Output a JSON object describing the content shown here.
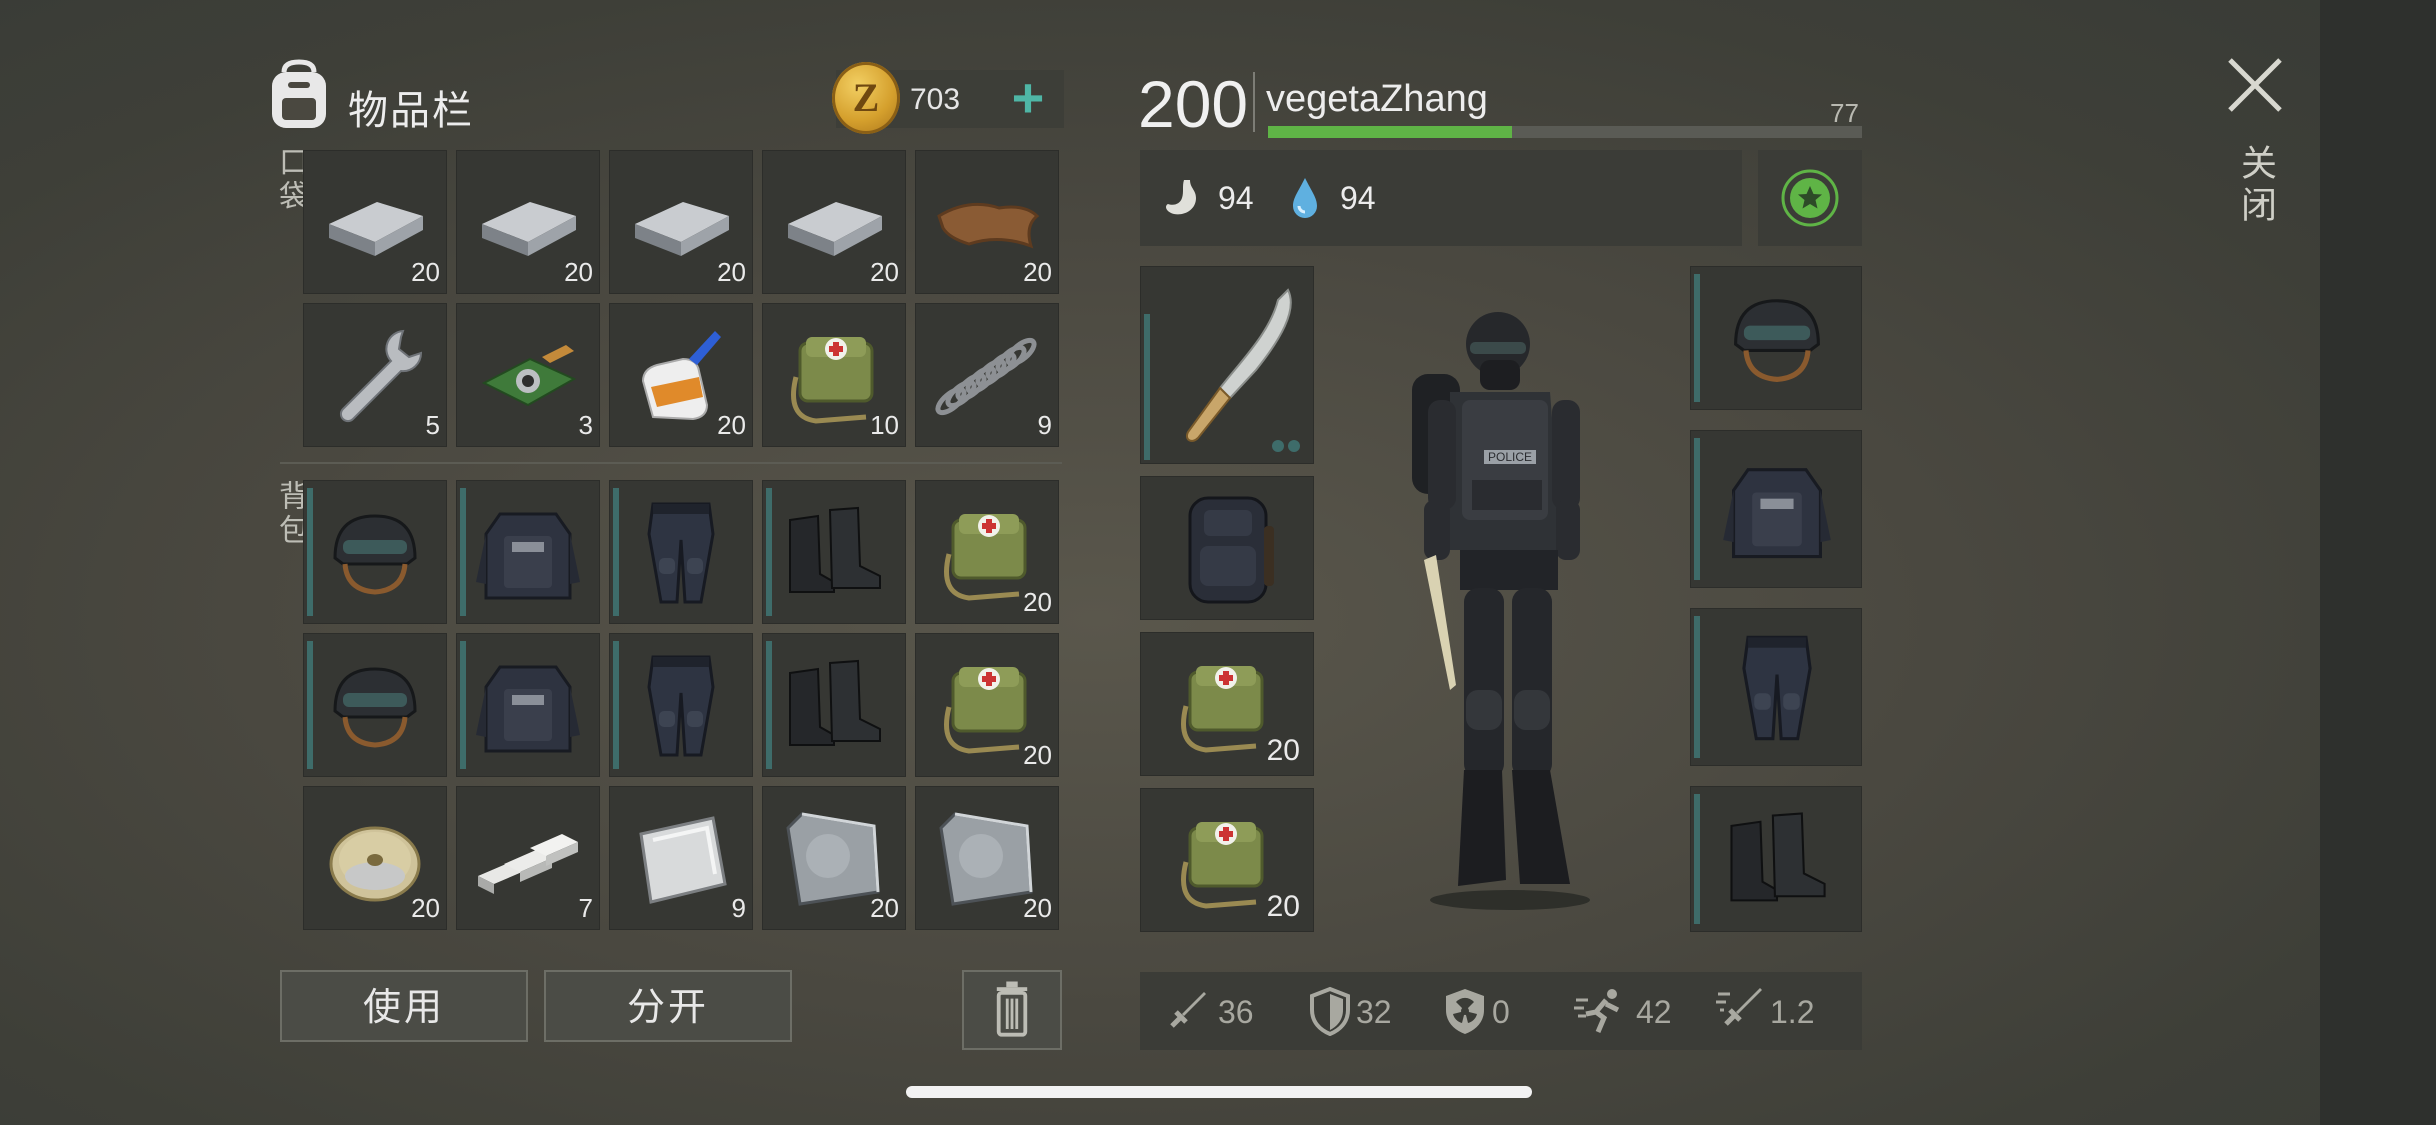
{
  "inventory": {
    "title": "物品栏",
    "coins": "703",
    "coin_symbol": "Z",
    "add_label": "+",
    "pocket_label": "口袋",
    "backpack_label": "背包",
    "pocket_items": [
      {
        "name": "iron-ingot",
        "count": "20"
      },
      {
        "name": "iron-ingot",
        "count": "20"
      },
      {
        "name": "iron-ingot",
        "count": "20"
      },
      {
        "name": "iron-ingot",
        "count": "20"
      },
      {
        "name": "leather",
        "count": "20"
      },
      {
        "name": "wrench",
        "count": "5"
      },
      {
        "name": "circuit-board",
        "count": "3"
      },
      {
        "name": "glue",
        "count": "20"
      },
      {
        "name": "medkit-bag",
        "count": "10"
      },
      {
        "name": "spring",
        "count": "9"
      }
    ],
    "backpack_items": [
      {
        "name": "helmet",
        "count": ""
      },
      {
        "name": "police-vest",
        "count": ""
      },
      {
        "name": "police-pants",
        "count": ""
      },
      {
        "name": "boots",
        "count": ""
      },
      {
        "name": "medkit-bag",
        "count": "20"
      },
      {
        "name": "helmet",
        "count": ""
      },
      {
        "name": "police-vest",
        "count": ""
      },
      {
        "name": "police-pants",
        "count": ""
      },
      {
        "name": "boots",
        "count": ""
      },
      {
        "name": "medkit-bag",
        "count": "20"
      },
      {
        "name": "wire-spool",
        "count": "20"
      },
      {
        "name": "aluminum-bars",
        "count": "7"
      },
      {
        "name": "steel-plate",
        "count": "9"
      },
      {
        "name": "metal-sheet",
        "count": "20"
      },
      {
        "name": "metal-sheet",
        "count": "20"
      }
    ],
    "use_label": "使用",
    "split_label": "分开"
  },
  "character": {
    "level": "200",
    "name": "vegetaZhang",
    "xp_progress": 0.41,
    "xp_value": "77",
    "hunger": "94",
    "thirst": "94",
    "left_equipment": [
      {
        "name": "machete",
        "count": ""
      },
      {
        "name": "tactical-backpack",
        "count": ""
      },
      {
        "name": "medkit-bag",
        "count": "20"
      },
      {
        "name": "medkit-bag",
        "count": "20"
      }
    ],
    "right_equipment": [
      {
        "name": "helmet"
      },
      {
        "name": "police-vest"
      },
      {
        "name": "police-pants"
      },
      {
        "name": "boots"
      }
    ],
    "stats": {
      "attack": "36",
      "defense": "32",
      "radiation": "0",
      "speed": "42",
      "attack_speed": "1.2"
    },
    "vest_text": "POLICE"
  },
  "close_label": "关闭",
  "colors": {
    "accent": "#4fb6a6",
    "xp": "#5fb446",
    "coin": "#d5a02d"
  }
}
